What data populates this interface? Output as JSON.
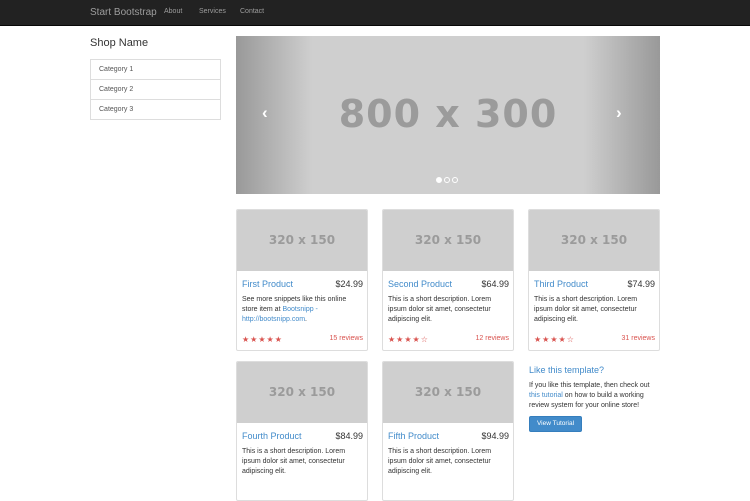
{
  "navbar": {
    "brand": "Start Bootstrap",
    "links": [
      "About",
      "Services",
      "Contact"
    ]
  },
  "sidebar": {
    "shop_name": "Shop Name",
    "categories": [
      "Category 1",
      "Category 2",
      "Category 3"
    ]
  },
  "carousel": {
    "placeholder": "800 x 300",
    "prev_symbol": "‹",
    "next_symbol": "›",
    "slide_count": 3,
    "active_slide": 1
  },
  "products": [
    {
      "image_placeholder": "320 x 150",
      "name": "First Product",
      "price": "$24.99",
      "desc_before": "See more snippets like this online store item at ",
      "desc_link": "Bootsnipp - http://bootsnipp.com",
      "desc_after": ".",
      "rating": 5,
      "stars": "★★★★★",
      "reviews": "15 reviews"
    },
    {
      "image_placeholder": "320 x 150",
      "name": "Second Product",
      "price": "$64.99",
      "desc_before": "This is a short description. Lorem ipsum dolor sit amet, consectetur adipiscing elit.",
      "desc_link": "",
      "desc_after": "",
      "rating": 4,
      "stars": "★★★★☆",
      "reviews": "12 reviews"
    },
    {
      "image_placeholder": "320 x 150",
      "name": "Third Product",
      "price": "$74.99",
      "desc_before": "This is a short description. Lorem ipsum dolor sit amet, consectetur adipiscing elit.",
      "desc_link": "",
      "desc_after": "",
      "rating": 4,
      "stars": "★★★★☆",
      "reviews": "31 reviews"
    },
    {
      "image_placeholder": "320 x 150",
      "name": "Fourth Product",
      "price": "$84.99",
      "desc_before": "This is a short description. Lorem ipsum dolor sit amet, consectetur adipiscing elit.",
      "desc_link": "",
      "desc_after": "",
      "stars": "",
      "reviews": ""
    },
    {
      "image_placeholder": "320 x 150",
      "name": "Fifth Product",
      "price": "$94.99",
      "desc_before": "This is a short description. Lorem ipsum dolor sit amet, consectetur adipiscing elit.",
      "desc_link": "",
      "desc_after": "",
      "stars": "",
      "reviews": ""
    }
  ],
  "promo": {
    "title": "Like this template?",
    "text_before": "If you like this template, then check out ",
    "link": "this tutorial",
    "text_after": " on how to build a working review system for your online store!",
    "button": "View Tutorial"
  },
  "colors": {
    "navbar_bg": "#222222",
    "link": "#428bca",
    "star": "#d9534f",
    "button": "#428bca"
  },
  "icons": {
    "carousel_prev": "chevron-left-icon",
    "carousel_next": "chevron-right-icon",
    "rating": "star-icon"
  }
}
